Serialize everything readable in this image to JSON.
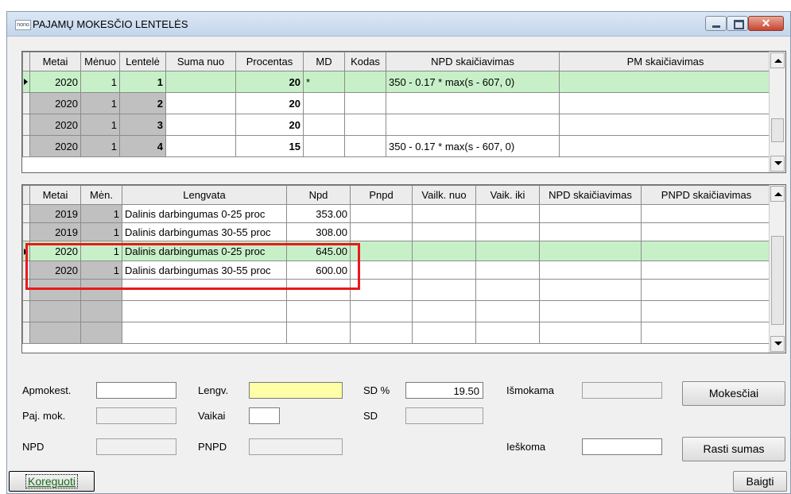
{
  "window": {
    "icon_text": "nono",
    "title": "PAJAMŲ MOKESČIO LENTELĖS",
    "close_glyph": "✕"
  },
  "top_grid": {
    "headers": [
      "Metai",
      "Mėnuo",
      "Lentelė",
      "Suma nuo",
      "Procentas",
      "MD",
      "Kodas",
      "NPD skaičiavimas",
      "PM skaičiavimas"
    ],
    "rows": [
      {
        "metai": "2020",
        "menuo": "1",
        "lentele": "1",
        "suma_nuo": "",
        "procentas": "20",
        "md": "*",
        "kodas": "",
        "npd": "350 - 0.17 * max(s - 607, 0)",
        "pm": ""
      },
      {
        "metai": "2020",
        "menuo": "1",
        "lentele": "2",
        "suma_nuo": "",
        "procentas": "20",
        "md": "",
        "kodas": "",
        "npd": "",
        "pm": ""
      },
      {
        "metai": "2020",
        "menuo": "1",
        "lentele": "3",
        "suma_nuo": "",
        "procentas": "20",
        "md": "",
        "kodas": "",
        "npd": "",
        "pm": ""
      },
      {
        "metai": "2020",
        "menuo": "1",
        "lentele": "4",
        "suma_nuo": "",
        "procentas": "15",
        "md": "",
        "kodas": "",
        "npd": "350 - 0.17 * max(s - 607, 0)",
        "pm": ""
      }
    ],
    "selected_row": 0
  },
  "bottom_grid": {
    "headers": [
      "Metai",
      "Mėn.",
      "Lengvata",
      "Npd",
      "Pnpd",
      "Vailk. nuo",
      "Vaik. iki",
      "NPD skaičiavimas",
      "PNPD skaičiavimas"
    ],
    "rows": [
      {
        "metai": "2019",
        "men": "1",
        "lengvata": "Dalinis darbingumas 0-25 proc",
        "npd": "353.00"
      },
      {
        "metai": "2019",
        "men": "1",
        "lengvata": "Dalinis darbingumas 30-55 proc",
        "npd": "308.00"
      },
      {
        "metai": "2020",
        "men": "1",
        "lengvata": "Dalinis darbingumas 0-25 proc",
        "npd": "645.00"
      },
      {
        "metai": "2020",
        "men": "1",
        "lengvata": "Dalinis darbingumas 30-55 proc",
        "npd": "600.00"
      }
    ],
    "selected_row": 2,
    "empty_rows": 3
  },
  "form": {
    "apmokest_label": "Apmokest.",
    "apmokest_value": "",
    "paj_mok_label": "Paj. mok.",
    "paj_mok_value": "",
    "npd_label": "NPD",
    "npd_value": "",
    "lengv_label": "Lengv.",
    "lengv_value": "",
    "vaikai_label": "Vaikai",
    "vaikai_value": "",
    "pnpd_label": "PNPD",
    "pnpd_value": "",
    "sd_pct_label": "SD %",
    "sd_pct_value": "19.50",
    "sd_label": "SD",
    "sd_value": "",
    "ismokama_label": "Išmokama",
    "ismokama_value": "",
    "ieskoma_label": "Ieškoma",
    "ieskoma_value": ""
  },
  "buttons": {
    "mokesciai": "Mokesčiai",
    "rasti_sumas": "Rasti sumas",
    "koreguoti": "Koreguoti",
    "baigti": "Baigti"
  },
  "colors": {
    "selected_row_bg": "#c8f0c8",
    "highlight_box": "#e8191c",
    "lengv_field_bg": "#ffffa8"
  }
}
